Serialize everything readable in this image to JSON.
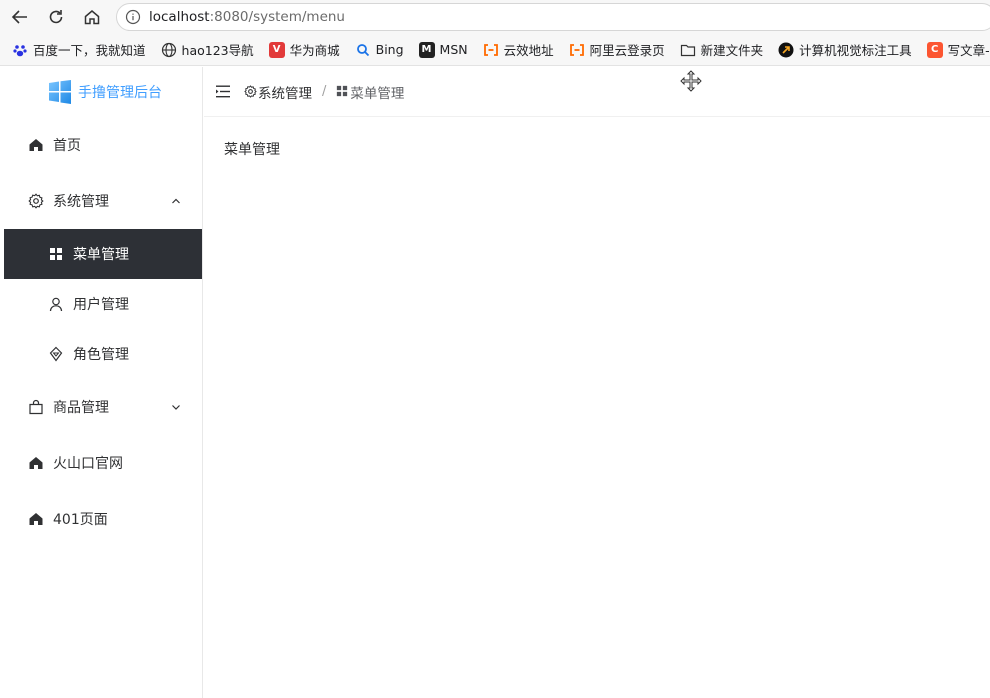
{
  "browser": {
    "url_host": "localhost",
    "url_rest": ":8080/system/menu"
  },
  "bookmarks": [
    {
      "label": "百度一下，我就知道",
      "icon": "baidu-paw-icon",
      "color": "#2932e1"
    },
    {
      "label": "hao123导航",
      "icon": "globe-icon",
      "color": "#333333"
    },
    {
      "label": "华为商城",
      "icon": "huawei-v-icon",
      "color": "#e23a3a"
    },
    {
      "label": "Bing",
      "icon": "search-icon",
      "color": "#1a73e8"
    },
    {
      "label": "MSN",
      "icon": "msn-icon",
      "color": "#222222"
    },
    {
      "label": "云效地址",
      "icon": "aliyun-icon",
      "color": "#ff6a00"
    },
    {
      "label": "阿里云登录页",
      "icon": "aliyun-icon",
      "color": "#ff6a00"
    },
    {
      "label": "新建文件夹",
      "icon": "folder-icon",
      "color": "#333333"
    },
    {
      "label": "计算机视觉标注工具",
      "icon": "arrow-circle-icon",
      "color": "#111111"
    },
    {
      "label": "写文章-CS",
      "icon": "csdn-icon",
      "color": "#fc5531"
    }
  ],
  "sidebar": {
    "logo_text": "手撸管理后台",
    "home": "首页",
    "system": "系统管理",
    "menu_mgmt": "菜单管理",
    "user_mgmt": "用户管理",
    "role_mgmt": "角色管理",
    "goods": "商品管理",
    "volcano": "火山口官网",
    "page401": "401页面"
  },
  "breadcrumb": {
    "first": "系统管理",
    "separator": "/",
    "current": "菜单管理"
  },
  "content": {
    "title": "菜单管理"
  },
  "colors": {
    "accent": "#409eff",
    "active_bg": "#2d3036"
  }
}
